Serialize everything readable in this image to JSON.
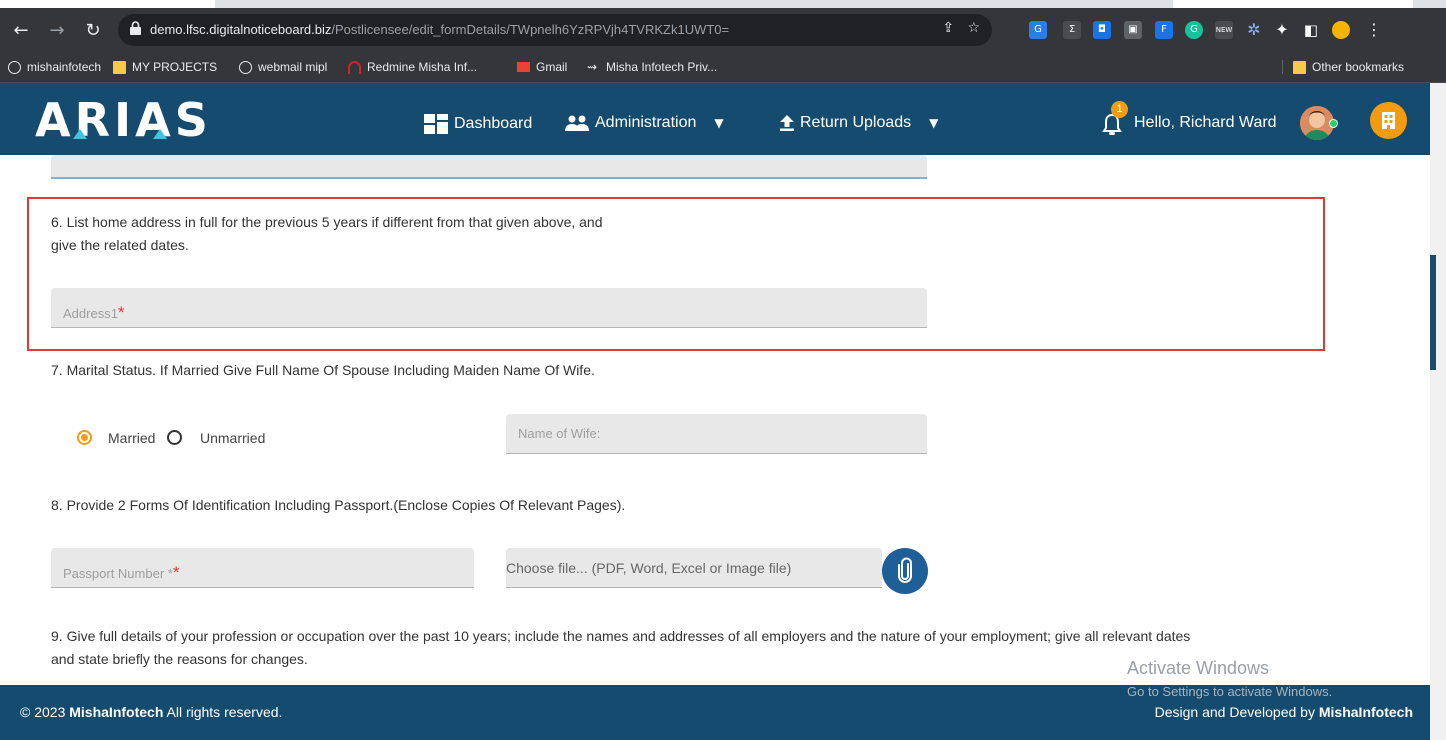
{
  "browser": {
    "url_host": "demo.lfsc.digitalnoticeboard.biz",
    "url_path": "/Postlicensee/edit_formDetails/TWpnelh6YzRPVjh4TVRKZk1UWT0=",
    "bookmarks": [
      "mishainfotech",
      "MY PROJECTS",
      "webmail mipl",
      "Redmine Misha Inf...",
      "Gmail",
      "Misha Infotech Priv..."
    ],
    "other_bookmarks": "Other bookmarks"
  },
  "header": {
    "logo": "ARIAS",
    "nav": {
      "dashboard": "Dashboard",
      "administration": "Administration",
      "return_uploads": "Return Uploads"
    },
    "notification_count": "1",
    "greeting": "Hello, Richard Ward"
  },
  "form": {
    "q6": {
      "text_line1": "6. List home address in full for the previous 5 years if different from that given above, and",
      "text_line2": "give the related dates.",
      "address_placeholder": "Address1"
    },
    "q7": {
      "text": "7. Marital Status. If Married Give Full Name Of Spouse Including Maiden Name Of Wife.",
      "married_label": "Married",
      "unmarried_label": "Unmarried",
      "selected": "Married",
      "wife_placeholder": "Name of Wife:"
    },
    "q8": {
      "text": "8. Provide 2 Forms Of Identification Including Passport.(Enclose Copies Of Relevant Pages).",
      "passport_placeholder": "Passport Number *",
      "file_placeholder": "Choose file... (PDF, Word, Excel or Image file)"
    },
    "q9": {
      "text_line1": "9. Give full details of your profession or occupation over the past 10 years; include the names and addresses of all employers and the nature of your employment; give all relevant dates",
      "text_line2": "and state briefly the reasons for changes."
    }
  },
  "watermark": {
    "title": "Activate Windows",
    "subtitle": "Go to Settings to activate Windows."
  },
  "footer": {
    "copyright_prefix": "© 2023 ",
    "company": "MishaInfotech",
    "copyright_suffix": " All rights reserved.",
    "credit_prefix": "Design and Developed by ",
    "credit_company": "MishaInfotech"
  },
  "colors": {
    "header_bg": "#154b6e",
    "accent_orange": "#f39c12",
    "highlight_red": "#e53935"
  }
}
